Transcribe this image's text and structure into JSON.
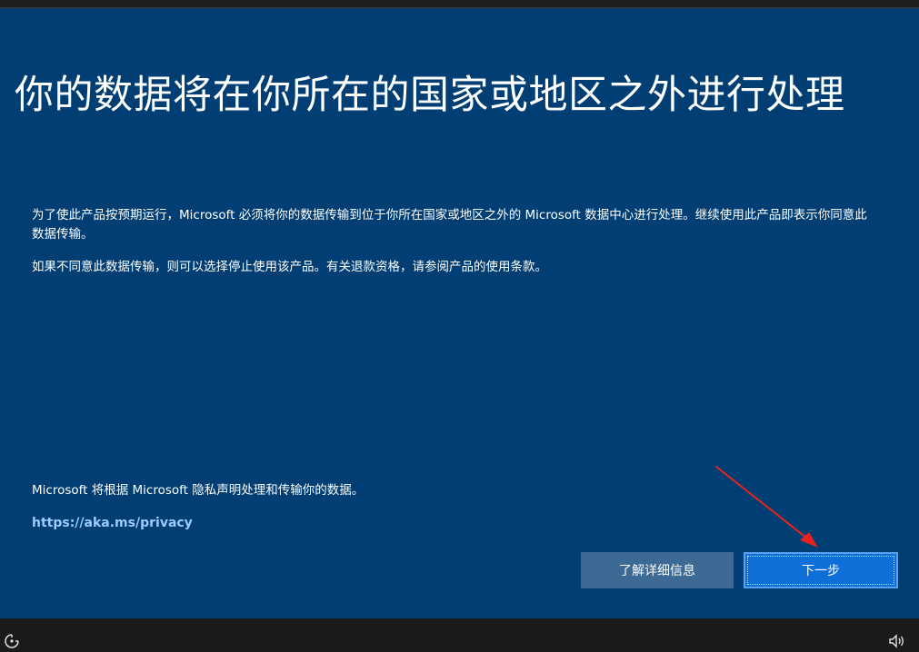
{
  "page": {
    "title": "你的数据将在你所在的国家或地区之外进行处理",
    "paragraph1": "为了使此产品按预期运行，Microsoft 必须将你的数据传输到位于你所在国家或地区之外的 Microsoft 数据中心进行处理。继续使用此产品即表示你同意此数据传输。",
    "paragraph2": "如果不同意此数据传输，则可以选择停止使用该产品。有关退款资格，请参阅产品的使用条款。",
    "privacy_note": "Microsoft 将根据 Microsoft 隐私声明处理和传输你的数据。",
    "privacy_link": "https://aka.ms/privacy"
  },
  "buttons": {
    "learn_more_label": "了解详细信息",
    "next_label": "下一步"
  },
  "taskbar": {
    "left_icon": "accessibility-icon",
    "right_icon": "volume-icon"
  },
  "colors": {
    "background": "#003e73",
    "primary_button": "#0f6fd8",
    "secondary_button": "#3d6a94",
    "link": "#9ccbff",
    "annotation_arrow": "#e8231e"
  }
}
